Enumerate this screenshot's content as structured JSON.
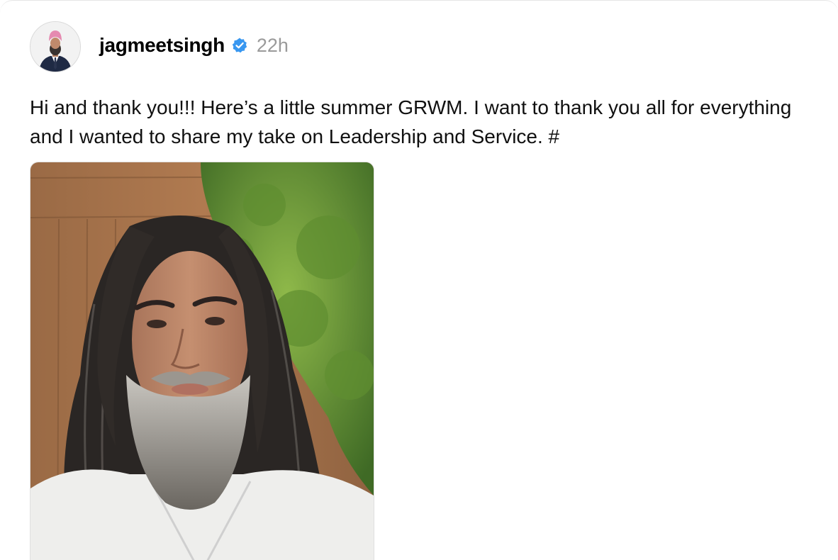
{
  "post": {
    "author": {
      "username": "jagmeetsingh",
      "verified_icon": "verified-badge-icon",
      "avatar_icon": "avatar-photo"
    },
    "time_ago": "22h",
    "caption": "Hi and thank you!!! Here’s a little summer GRWM. I want to thank you all for everything and I wanted to share my take on Leadership and Service. #",
    "media": {
      "type": "video-thumbnail"
    }
  },
  "colors": {
    "verified_blue": "#3897f0",
    "username": "#000000",
    "timestamp": "#9a9a9a",
    "caption_text": "#101010"
  }
}
